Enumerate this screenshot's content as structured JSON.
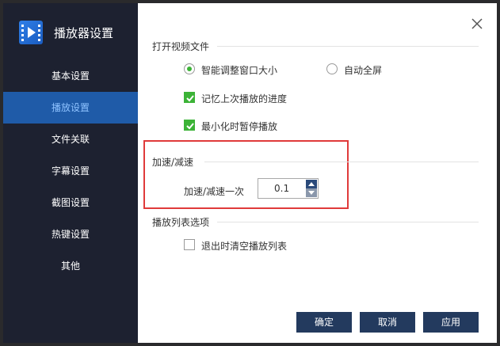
{
  "sidebar": {
    "title": "播放器设置",
    "items": [
      {
        "label": "基本设置",
        "active": false
      },
      {
        "label": "播放设置",
        "active": true
      },
      {
        "label": "文件关联",
        "active": false
      },
      {
        "label": "字幕设置",
        "active": false
      },
      {
        "label": "截图设置",
        "active": false
      },
      {
        "label": "热键设置",
        "active": false
      },
      {
        "label": "其他",
        "active": false
      }
    ]
  },
  "open_video": {
    "title": "打开视频文件",
    "radio_auto_resize": "智能调整窗口大小",
    "radio_fullscreen": "自动全屏",
    "check_remember": "记忆上次播放的进度",
    "check_pause_minimize": "最小化时暂停播放"
  },
  "speed": {
    "title": "加速/减速",
    "step_label": "加速/减速一次",
    "step_value": "0.1"
  },
  "playlist": {
    "title": "播放列表选项",
    "check_clear_on_exit": "退出时清空播放列表"
  },
  "buttons": {
    "ok": "确定",
    "cancel": "取消",
    "apply": "应用"
  },
  "colors": {
    "sidebar_bg": "#1d2130",
    "active_item_bg": "#1f5ba8",
    "check_green": "#3cb337",
    "button_bg": "#233a5e",
    "highlight_red": "#e03a3a"
  }
}
